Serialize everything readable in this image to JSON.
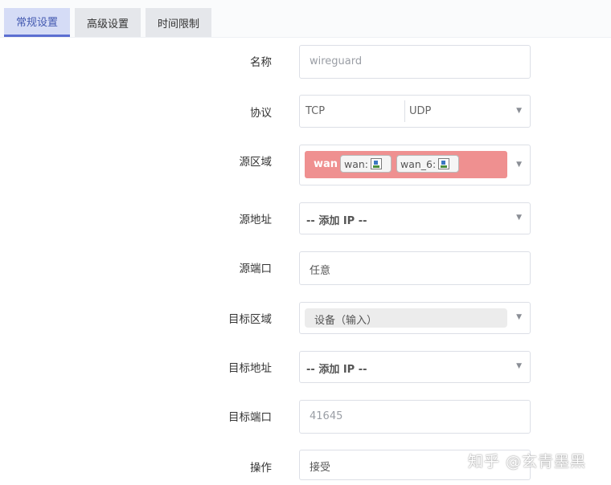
{
  "tabs": [
    {
      "label": "常规设置",
      "active": true
    },
    {
      "label": "高级设置",
      "active": false
    },
    {
      "label": "时间限制",
      "active": false
    }
  ],
  "form": {
    "name": {
      "label": "名称",
      "value": "wireguard"
    },
    "protocol": {
      "label": "协议",
      "values": [
        "TCP",
        "UDP"
      ]
    },
    "src_zone": {
      "label": "源区域",
      "zone": "wan",
      "tags": [
        "wan:",
        "wan_6:"
      ],
      "color": "#ef9090",
      "icon": "network-interface-icon"
    },
    "src_addr": {
      "label": "源地址",
      "value": "-- 添加 IP --"
    },
    "src_port": {
      "label": "源端口",
      "value": "任意"
    },
    "dest_zone": {
      "label": "目标区域",
      "value": "设备（输入）"
    },
    "dest_addr": {
      "label": "目标地址",
      "value": "-- 添加 IP --"
    },
    "dest_port": {
      "label": "目标端口",
      "value": "41645"
    },
    "action": {
      "label": "操作",
      "value": "接受"
    }
  },
  "watermark": "知乎 @玄青墨黑"
}
